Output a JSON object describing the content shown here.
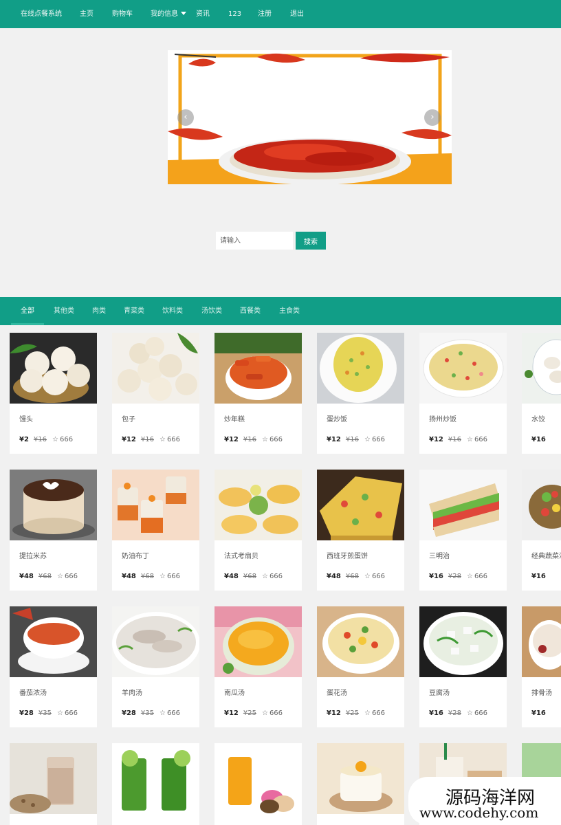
{
  "nav": {
    "brand": "在线点餐系统",
    "home": "主页",
    "cart": "购物车",
    "my_info": "我的信息",
    "news": "资讯",
    "user": "123",
    "register": "注册",
    "logout": "退出"
  },
  "search": {
    "placeholder": "请输入",
    "button": "搜索"
  },
  "categories": [
    "全部",
    "其他类",
    "肉类",
    "青菜类",
    "饮料类",
    "汤饮类",
    "西餐类",
    "主食类"
  ],
  "active_category": "全部",
  "foods": [
    {
      "name": "馒头",
      "price": "¥2",
      "old_price": "¥16",
      "likes": "666"
    },
    {
      "name": "包子",
      "price": "¥12",
      "old_price": "¥16",
      "likes": "666"
    },
    {
      "name": "炒年糕",
      "price": "¥12",
      "old_price": "¥16",
      "likes": "666"
    },
    {
      "name": "蛋炒饭",
      "price": "¥12",
      "old_price": "¥16",
      "likes": "666"
    },
    {
      "name": "扬州炒饭",
      "price": "¥12",
      "old_price": "¥16",
      "likes": "666"
    },
    {
      "name": "水饺",
      "price": "¥16",
      "old_price": "",
      "likes": ""
    },
    {
      "name": "提拉米苏",
      "price": "¥48",
      "old_price": "¥68",
      "likes": "666"
    },
    {
      "name": "奶油布丁",
      "price": "¥48",
      "old_price": "¥68",
      "likes": "666"
    },
    {
      "name": "法式考扇贝",
      "price": "¥48",
      "old_price": "¥68",
      "likes": "666"
    },
    {
      "name": "西班牙煎蛋饼",
      "price": "¥48",
      "old_price": "¥68",
      "likes": "666"
    },
    {
      "name": "三明治",
      "price": "¥16",
      "old_price": "¥28",
      "likes": "666"
    },
    {
      "name": "经典蔬菜沙",
      "price": "¥16",
      "old_price": "",
      "likes": ""
    },
    {
      "name": "番茄浓汤",
      "price": "¥28",
      "old_price": "¥35",
      "likes": "666"
    },
    {
      "name": "羊肉汤",
      "price": "¥28",
      "old_price": "¥35",
      "likes": "666"
    },
    {
      "name": "南瓜汤",
      "price": "¥12",
      "old_price": "¥25",
      "likes": "666"
    },
    {
      "name": "蛋花汤",
      "price": "¥12",
      "old_price": "¥25",
      "likes": "666"
    },
    {
      "name": "豆腐汤",
      "price": "¥16",
      "old_price": "¥28",
      "likes": "666"
    },
    {
      "name": "排骨汤",
      "price": "¥16",
      "old_price": "",
      "likes": ""
    }
  ],
  "watermark": {
    "name": "源码海洋网",
    "url": "www.codehy.com"
  },
  "colors": {
    "primary": "#119e87",
    "background": "#f1f1f1"
  }
}
